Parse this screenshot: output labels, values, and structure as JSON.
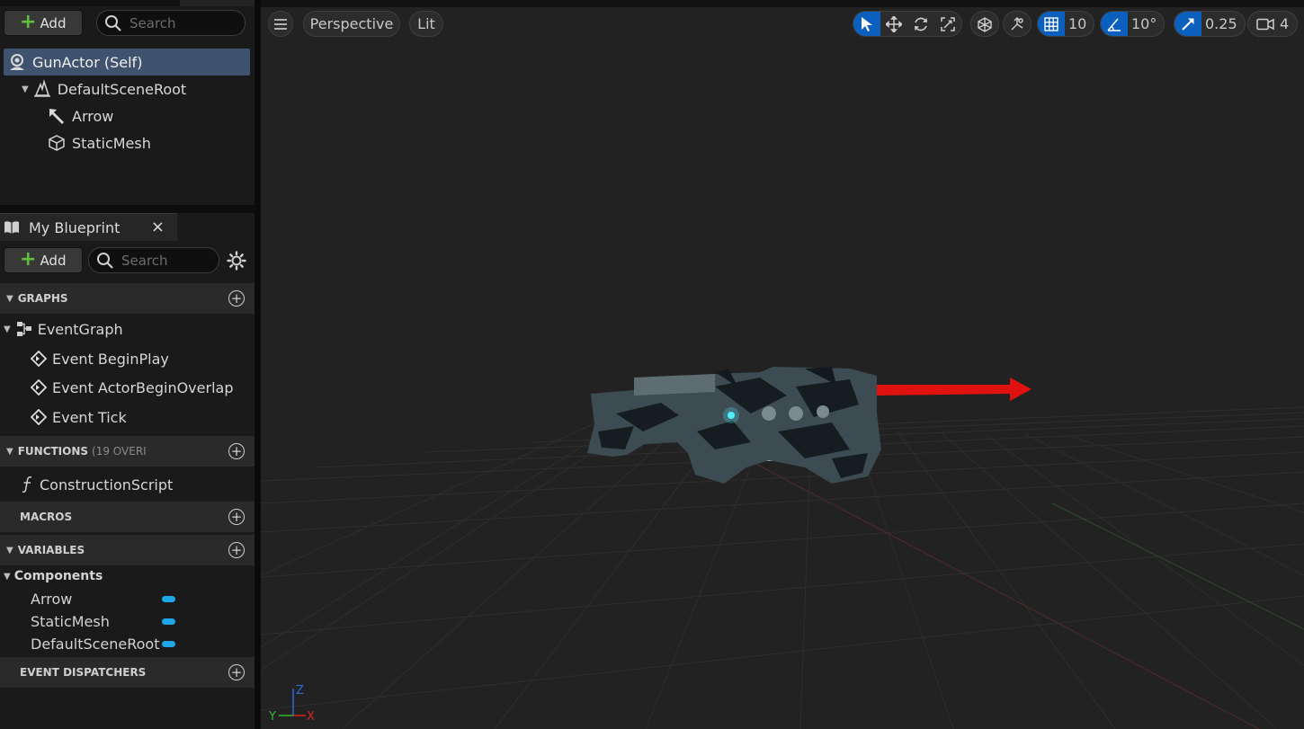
{
  "components": {
    "add_label": "Add",
    "search_placeholder": "Search",
    "tree": [
      {
        "label": "GunActor (Self)",
        "icon": "actor-icon"
      },
      {
        "label": "DefaultSceneRoot",
        "icon": "scene-root-icon"
      },
      {
        "label": "Arrow",
        "icon": "arrow-component-icon"
      },
      {
        "label": "StaticMesh",
        "icon": "static-mesh-icon"
      }
    ]
  },
  "my_blueprint": {
    "tab_label": "My Blueprint",
    "close_glyph": "×",
    "add_label": "Add",
    "search_placeholder": "Search",
    "sections": {
      "graphs": "GRAPHS",
      "functions": "FUNCTIONS",
      "functions_sub": "(19 OVERI",
      "macros": "MACROS",
      "variables": "VARIABLES",
      "event_dispatchers": "EVENT DISPATCHERS"
    },
    "event_graph": "EventGraph",
    "events": [
      "Event BeginPlay",
      "Event ActorBeginOverlap",
      "Event Tick"
    ],
    "construction_script": "ConstructionScript",
    "components_category": "Components",
    "variables": [
      "Arrow",
      "StaticMesh",
      "DefaultSceneRoot"
    ],
    "variable_color": "#1ea7e8"
  },
  "viewport": {
    "perspective_label": "Perspective",
    "lit_label": "Lit",
    "grid_snap": "10",
    "rotation_snap": "10°",
    "scale_snap": "0.25",
    "camera_speed": "4",
    "accent_color": "#0b5fbd",
    "axis_labels": {
      "x": "X",
      "y": "Y",
      "z": "Z"
    }
  }
}
